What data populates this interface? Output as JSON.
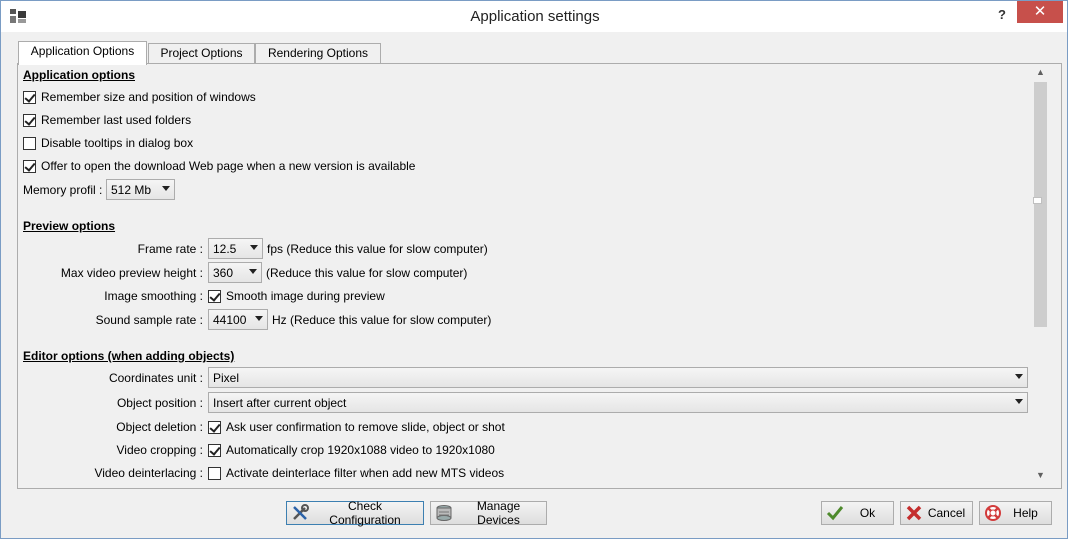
{
  "window": {
    "title": "Application settings",
    "help_glyph": "?",
    "close_glyph": "✕"
  },
  "tabs": [
    {
      "label": "Application Options",
      "active": true
    },
    {
      "label": "Project Options",
      "active": false
    },
    {
      "label": "Rendering Options",
      "active": false
    }
  ],
  "application_options": {
    "heading": "Application options",
    "remember_windows": {
      "label": "Remember size and position of windows",
      "checked": true
    },
    "remember_folders": {
      "label": "Remember last used folders",
      "checked": true
    },
    "disable_tooltips": {
      "label": "Disable tooltips in dialog box",
      "checked": false
    },
    "offer_download": {
      "label": "Offer to open the download Web page when a new version is available",
      "checked": true
    },
    "memory_profil": {
      "label": "Memory profil :",
      "value": "512 Mb"
    }
  },
  "preview_options": {
    "heading": "Preview options",
    "frame_rate": {
      "label": "Frame rate :",
      "value": "12.5",
      "suffix": "fps (Reduce this value for slow computer)"
    },
    "max_height": {
      "label": "Max video preview height :",
      "value": "360",
      "suffix": "(Reduce this value for slow computer)"
    },
    "image_smoothing": {
      "label": "Image smoothing :",
      "checkbox_label": "Smooth image during preview",
      "checked": true
    },
    "sound_rate": {
      "label": "Sound sample rate :",
      "value": "44100",
      "suffix": "Hz (Reduce this value for slow computer)"
    }
  },
  "editor_options": {
    "heading": "Editor options (when adding objects)",
    "coordinates_unit": {
      "label": "Coordinates unit :",
      "value": "Pixel"
    },
    "object_position": {
      "label": "Object position :",
      "value": "Insert after current object"
    },
    "object_deletion": {
      "label": "Object deletion :",
      "checkbox_label": "Ask user confirmation to remove slide, object or shot",
      "checked": true
    },
    "video_cropping": {
      "label": "Video cropping :",
      "checkbox_label": "Automatically crop 1920x1088 video to 1920x1080",
      "checked": true
    },
    "video_deinterlacing": {
      "label": "Video deinterlacing :",
      "checkbox_label": "Activate deinterlace filter when add new MTS videos",
      "checked": false
    }
  },
  "buttons": {
    "check_configuration": "Check Configuration",
    "manage_devices": "Manage Devices",
    "ok": "Ok",
    "cancel": "Cancel",
    "help": "Help"
  },
  "icons": {
    "app": "app-icon",
    "check_configuration": "tools-icon",
    "manage_devices": "devices-icon",
    "ok": "check-icon",
    "cancel": "cancel-x-icon",
    "help": "help-cross-icon"
  },
  "colors": {
    "close_button": "#c7504b",
    "focus_border": "#3c7fb1",
    "window_border": "#7a9cc4"
  }
}
